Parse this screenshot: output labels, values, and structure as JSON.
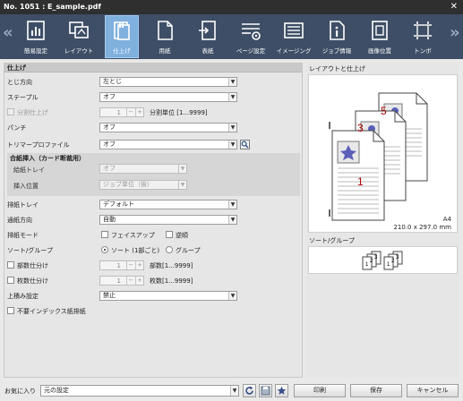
{
  "window": {
    "title": "No. 1051 : E_sample.pdf",
    "close_glyph": "✕"
  },
  "nav": {
    "prev_glyph": "«",
    "next_glyph": "»"
  },
  "tabs": [
    {
      "label": "簡易設定",
      "icon": "checklist-icon"
    },
    {
      "label": "レイアウト",
      "icon": "layout-icon"
    },
    {
      "label": "仕上げ",
      "icon": "finishing-icon",
      "active": true
    },
    {
      "label": "用紙",
      "icon": "paper-icon"
    },
    {
      "label": "表紙",
      "icon": "cover-icon"
    },
    {
      "label": "ページ設定",
      "icon": "page-settings-icon"
    },
    {
      "label": "イメージング",
      "icon": "imaging-icon"
    },
    {
      "label": "ジョブ情報",
      "icon": "job-info-icon"
    },
    {
      "label": "画像位置",
      "icon": "image-position-icon"
    },
    {
      "label": "トンボ",
      "icon": "crop-marks-icon"
    }
  ],
  "section_title": "仕上げ",
  "form": {
    "binding": {
      "label": "とじ方向",
      "value": "左とじ"
    },
    "staple": {
      "label": "ステープル",
      "value": "オフ"
    },
    "split": {
      "label": "分割仕上げ",
      "value": "1",
      "unit": "分割単位 [1...9999]"
    },
    "punch": {
      "label": "パンチ",
      "value": "オフ"
    },
    "trimmer": {
      "label": "トリマープロファイル",
      "value": "オフ"
    },
    "insert": {
      "title": "合紙挿入（カード断裁用）",
      "tray_label": "給紙トレイ",
      "tray_value": "オフ",
      "pos_label": "挿入位置",
      "pos_value": "ジョブ単位（後）"
    },
    "output_tray": {
      "label": "排紙トレイ",
      "value": "デフォルト"
    },
    "feed_dir": {
      "label": "通紙方向",
      "value": "自動"
    },
    "output_mode": {
      "label": "排紙モード",
      "opt1": "フェイスアップ",
      "opt2": "逆順"
    },
    "sort_group": {
      "label": "ソート/グループ",
      "opt1": "ソート (1部ごと)",
      "opt2": "グループ"
    },
    "copies_split": {
      "label": "部数仕分け",
      "value": "1",
      "unit": "部数[1...9999]"
    },
    "sheets_split": {
      "label": "枚数仕分け",
      "value": "1",
      "unit": "枚数[1...9999]"
    },
    "stacking": {
      "label": "上積み設定",
      "value": "禁止"
    },
    "no_index": {
      "label": "不要インデックス紙排紙"
    }
  },
  "right": {
    "layout_title": "レイアウトと仕上げ",
    "paper_size": "A4",
    "paper_dims": "210.0 x 297.0 mm",
    "page_numbers": [
      "1",
      "3",
      "5"
    ],
    "sort_title": "ソート/グループ",
    "sort_numbers": [
      "1",
      "2",
      "3"
    ]
  },
  "bottom": {
    "favorites_label": "お気に入り",
    "favorites_value": "元の設定",
    "print": "印刷",
    "save": "保存",
    "cancel": "キャンセル"
  },
  "colors": {
    "toolbar": "#3e4e66",
    "active_tab": "#7fb0de",
    "page_number": "#b00000"
  }
}
